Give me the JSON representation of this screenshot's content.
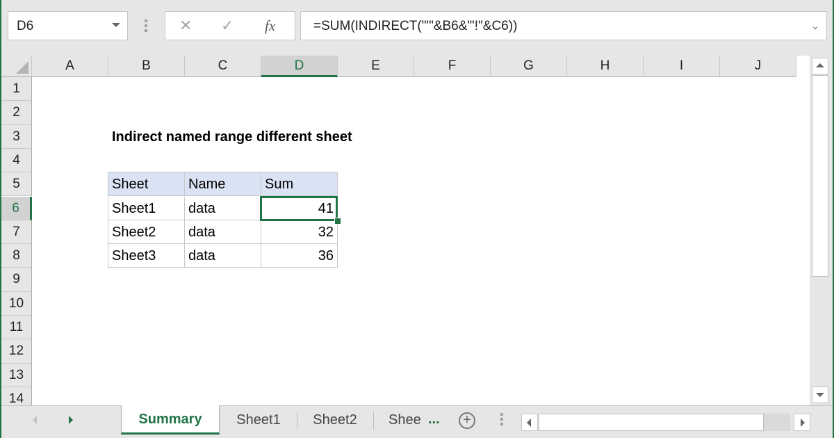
{
  "formula_bar": {
    "name_box": "D6",
    "cancel_icon": "✕",
    "enter_icon": "✓",
    "fx_label": "fx",
    "formula": "=SUM(INDIRECT(\"'\"&B6&\"'!\"&C6))",
    "expand_icon": "⌄"
  },
  "columns": [
    "A",
    "B",
    "C",
    "D",
    "E",
    "F",
    "G",
    "H",
    "I",
    "J"
  ],
  "selected_column": "D",
  "rows": [
    "1",
    "2",
    "3",
    "4",
    "5",
    "6",
    "7",
    "8",
    "9",
    "10",
    "11",
    "12",
    "13",
    "14"
  ],
  "selected_row": "6",
  "sheet": {
    "title": "Indirect named range different sheet",
    "table": {
      "headers": [
        "Sheet",
        "Name",
        "Sum"
      ],
      "rows": [
        [
          "Sheet1",
          "data",
          "41"
        ],
        [
          "Sheet2",
          "data",
          "32"
        ],
        [
          "Sheet3",
          "data",
          "36"
        ]
      ]
    },
    "active_cell": "D6"
  },
  "tabs": {
    "items": [
      {
        "label": "Summary",
        "active": true
      },
      {
        "label": "Sheet1",
        "active": false
      },
      {
        "label": "Sheet2",
        "active": false
      },
      {
        "label": "Shee",
        "active": false
      }
    ],
    "more": "...",
    "add_icon": "+"
  },
  "colors": {
    "accent": "#217346",
    "table_header_fill": "#dae3f3"
  }
}
